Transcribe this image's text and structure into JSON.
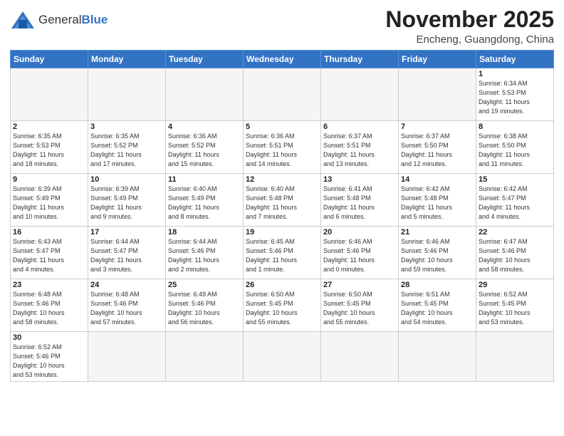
{
  "header": {
    "logo_general": "General",
    "logo_blue": "Blue",
    "month": "November 2025",
    "location": "Encheng, Guangdong, China"
  },
  "weekdays": [
    "Sunday",
    "Monday",
    "Tuesday",
    "Wednesday",
    "Thursday",
    "Friday",
    "Saturday"
  ],
  "weeks": [
    [
      {
        "day": "",
        "info": ""
      },
      {
        "day": "",
        "info": ""
      },
      {
        "day": "",
        "info": ""
      },
      {
        "day": "",
        "info": ""
      },
      {
        "day": "",
        "info": ""
      },
      {
        "day": "",
        "info": ""
      },
      {
        "day": "1",
        "info": "Sunrise: 6:34 AM\nSunset: 5:53 PM\nDaylight: 11 hours\nand 19 minutes."
      }
    ],
    [
      {
        "day": "2",
        "info": "Sunrise: 6:35 AM\nSunset: 5:53 PM\nDaylight: 11 hours\nand 18 minutes."
      },
      {
        "day": "3",
        "info": "Sunrise: 6:35 AM\nSunset: 5:52 PM\nDaylight: 11 hours\nand 17 minutes."
      },
      {
        "day": "4",
        "info": "Sunrise: 6:36 AM\nSunset: 5:52 PM\nDaylight: 11 hours\nand 15 minutes."
      },
      {
        "day": "5",
        "info": "Sunrise: 6:36 AM\nSunset: 5:51 PM\nDaylight: 11 hours\nand 14 minutes."
      },
      {
        "day": "6",
        "info": "Sunrise: 6:37 AM\nSunset: 5:51 PM\nDaylight: 11 hours\nand 13 minutes."
      },
      {
        "day": "7",
        "info": "Sunrise: 6:37 AM\nSunset: 5:50 PM\nDaylight: 11 hours\nand 12 minutes."
      },
      {
        "day": "8",
        "info": "Sunrise: 6:38 AM\nSunset: 5:50 PM\nDaylight: 11 hours\nand 11 minutes."
      }
    ],
    [
      {
        "day": "9",
        "info": "Sunrise: 6:39 AM\nSunset: 5:49 PM\nDaylight: 11 hours\nand 10 minutes."
      },
      {
        "day": "10",
        "info": "Sunrise: 6:39 AM\nSunset: 5:49 PM\nDaylight: 11 hours\nand 9 minutes."
      },
      {
        "day": "11",
        "info": "Sunrise: 6:40 AM\nSunset: 5:49 PM\nDaylight: 11 hours\nand 8 minutes."
      },
      {
        "day": "12",
        "info": "Sunrise: 6:40 AM\nSunset: 5:48 PM\nDaylight: 11 hours\nand 7 minutes."
      },
      {
        "day": "13",
        "info": "Sunrise: 6:41 AM\nSunset: 5:48 PM\nDaylight: 11 hours\nand 6 minutes."
      },
      {
        "day": "14",
        "info": "Sunrise: 6:42 AM\nSunset: 5:48 PM\nDaylight: 11 hours\nand 5 minutes."
      },
      {
        "day": "15",
        "info": "Sunrise: 6:42 AM\nSunset: 5:47 PM\nDaylight: 11 hours\nand 4 minutes."
      }
    ],
    [
      {
        "day": "16",
        "info": "Sunrise: 6:43 AM\nSunset: 5:47 PM\nDaylight: 11 hours\nand 4 minutes."
      },
      {
        "day": "17",
        "info": "Sunrise: 6:44 AM\nSunset: 5:47 PM\nDaylight: 11 hours\nand 3 minutes."
      },
      {
        "day": "18",
        "info": "Sunrise: 6:44 AM\nSunset: 5:46 PM\nDaylight: 11 hours\nand 2 minutes."
      },
      {
        "day": "19",
        "info": "Sunrise: 6:45 AM\nSunset: 5:46 PM\nDaylight: 11 hours\nand 1 minute."
      },
      {
        "day": "20",
        "info": "Sunrise: 6:46 AM\nSunset: 5:46 PM\nDaylight: 11 hours\nand 0 minutes."
      },
      {
        "day": "21",
        "info": "Sunrise: 6:46 AM\nSunset: 5:46 PM\nDaylight: 10 hours\nand 59 minutes."
      },
      {
        "day": "22",
        "info": "Sunrise: 6:47 AM\nSunset: 5:46 PM\nDaylight: 10 hours\nand 58 minutes."
      }
    ],
    [
      {
        "day": "23",
        "info": "Sunrise: 6:48 AM\nSunset: 5:46 PM\nDaylight: 10 hours\nand 58 minutes."
      },
      {
        "day": "24",
        "info": "Sunrise: 6:48 AM\nSunset: 5:46 PM\nDaylight: 10 hours\nand 57 minutes."
      },
      {
        "day": "25",
        "info": "Sunrise: 6:49 AM\nSunset: 5:46 PM\nDaylight: 10 hours\nand 56 minutes."
      },
      {
        "day": "26",
        "info": "Sunrise: 6:50 AM\nSunset: 5:45 PM\nDaylight: 10 hours\nand 55 minutes."
      },
      {
        "day": "27",
        "info": "Sunrise: 6:50 AM\nSunset: 5:45 PM\nDaylight: 10 hours\nand 55 minutes."
      },
      {
        "day": "28",
        "info": "Sunrise: 6:51 AM\nSunset: 5:45 PM\nDaylight: 10 hours\nand 54 minutes."
      },
      {
        "day": "29",
        "info": "Sunrise: 6:52 AM\nSunset: 5:45 PM\nDaylight: 10 hours\nand 53 minutes."
      }
    ],
    [
      {
        "day": "30",
        "info": "Sunrise: 6:52 AM\nSunset: 5:46 PM\nDaylight: 10 hours\nand 53 minutes."
      },
      {
        "day": "",
        "info": ""
      },
      {
        "day": "",
        "info": ""
      },
      {
        "day": "",
        "info": ""
      },
      {
        "day": "",
        "info": ""
      },
      {
        "day": "",
        "info": ""
      },
      {
        "day": "",
        "info": ""
      }
    ]
  ]
}
